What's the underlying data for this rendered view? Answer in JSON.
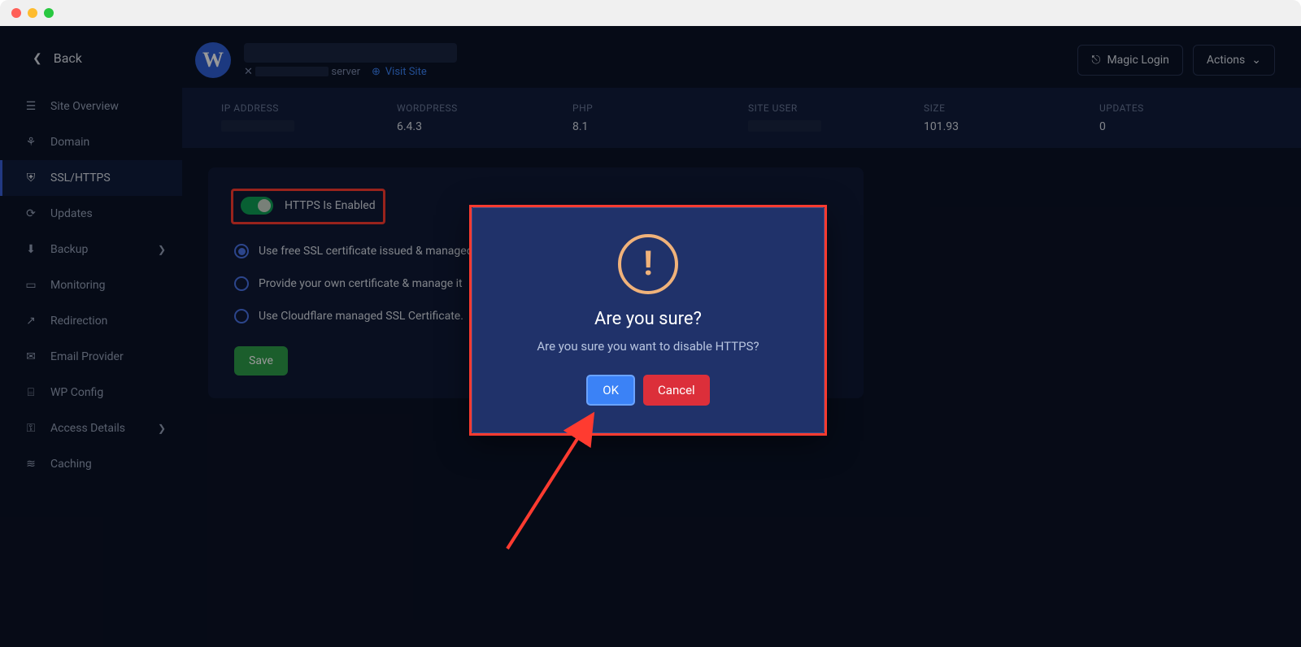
{
  "back_label": "Back",
  "sidebar": {
    "items": [
      {
        "label": "Site Overview",
        "icon": "☰"
      },
      {
        "label": "Domain",
        "icon": "⚘"
      },
      {
        "label": "SSL/HTTPS",
        "icon": "⛨"
      },
      {
        "label": "Updates",
        "icon": "⟳"
      },
      {
        "label": "Backup",
        "icon": "⬇",
        "chev": true
      },
      {
        "label": "Monitoring",
        "icon": "▭"
      },
      {
        "label": "Redirection",
        "icon": "↗"
      },
      {
        "label": "Email Provider",
        "icon": "✉"
      },
      {
        "label": "WP Config",
        "icon": "⌸"
      },
      {
        "label": "Access Details",
        "icon": "⚿",
        "chev": true
      },
      {
        "label": "Caching",
        "icon": "≋"
      }
    ],
    "active_index": 2
  },
  "header": {
    "server_text": "server",
    "visit_site": "Visit Site",
    "magic_login": "Magic Login",
    "actions": "Actions"
  },
  "info_bar": {
    "cols": [
      {
        "label": "IP ADDRESS",
        "value": ""
      },
      {
        "label": "WORDPRESS",
        "value": "6.4.3"
      },
      {
        "label": "PHP",
        "value": "8.1"
      },
      {
        "label": "SITE USER",
        "value": ""
      },
      {
        "label": "SIZE",
        "value": "101.93"
      },
      {
        "label": "UPDATES",
        "value": "0"
      }
    ]
  },
  "ssl_panel": {
    "toggle_label": "HTTPS Is Enabled",
    "options": [
      "Use free SSL certificate issued & managed",
      "Provide your own certificate & manage it",
      "Use Cloudflare managed SSL Certificate."
    ],
    "selected_option": 0,
    "save_label": "Save"
  },
  "modal": {
    "title": "Are you sure?",
    "text": "Are you sure you want to disable HTTPS?",
    "ok": "OK",
    "cancel": "Cancel"
  }
}
